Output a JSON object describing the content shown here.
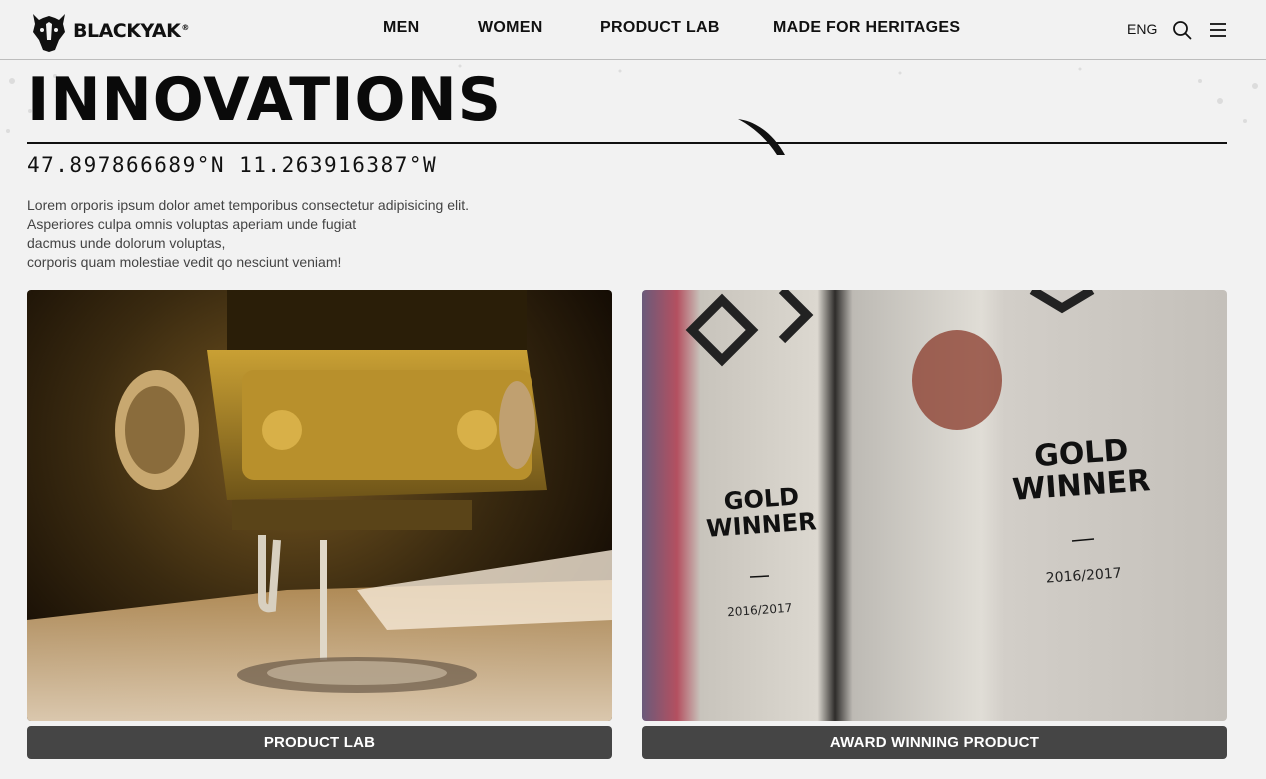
{
  "header": {
    "brand": "BLACKYAK",
    "brand_mark": "®",
    "nav": [
      "MEN",
      "WOMEN",
      "PRODUCT LAB",
      "MADE FOR HERITAGES"
    ],
    "language": "ENG",
    "icons": {
      "search": "search-icon",
      "menu": "hamburger-menu-icon",
      "logo": "yak-head-logo"
    }
  },
  "hero": {
    "title": "INNOVATIONS",
    "coordinates": "47.897866689°N 11.263916387°W",
    "description": [
      "Lorem orporis ipsum dolor amet temporibus consectetur adipisicing elit.",
      "Asperiores culpa omnis voluptas aperiam unde fugiat",
      "dacmus unde dolorum voluptas,",
      "corporis quam molestiae vedit qo nesciunt veniam!"
    ]
  },
  "cards": [
    {
      "button_label": "PRODUCT LAB"
    },
    {
      "button_label": "AWARD WINNING PRODUCT",
      "trophy_text": {
        "line1": "GOLD",
        "line2": "WINNER",
        "year": "2016/2017"
      }
    }
  ],
  "colors": {
    "background": "#f2f2f2",
    "button": "#454545",
    "text": "#111111"
  }
}
